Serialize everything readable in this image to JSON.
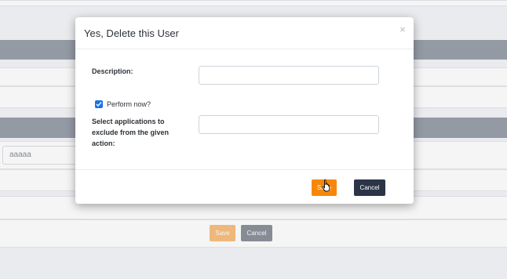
{
  "background": {
    "filter_input_value": "aaaaa",
    "save_label": "Save",
    "cancel_label": "Cancel"
  },
  "modal": {
    "title": "Yes, Delete this User",
    "close_icon": "close-icon",
    "description_label": "Description:",
    "description_value": "",
    "perform_now_label": "Perform now?",
    "perform_now_checked": true,
    "exclude_label_line1": "Select applications to",
    "exclude_label_line2": "exclude from the given",
    "exclude_label_line3": "action:",
    "exclude_value": "",
    "save_label": "Save",
    "cancel_label": "Cancel"
  },
  "colors": {
    "save_accent": "#f7870a",
    "cancel_dark": "#2b3547",
    "checkbox_blue": "#1a73e8"
  }
}
